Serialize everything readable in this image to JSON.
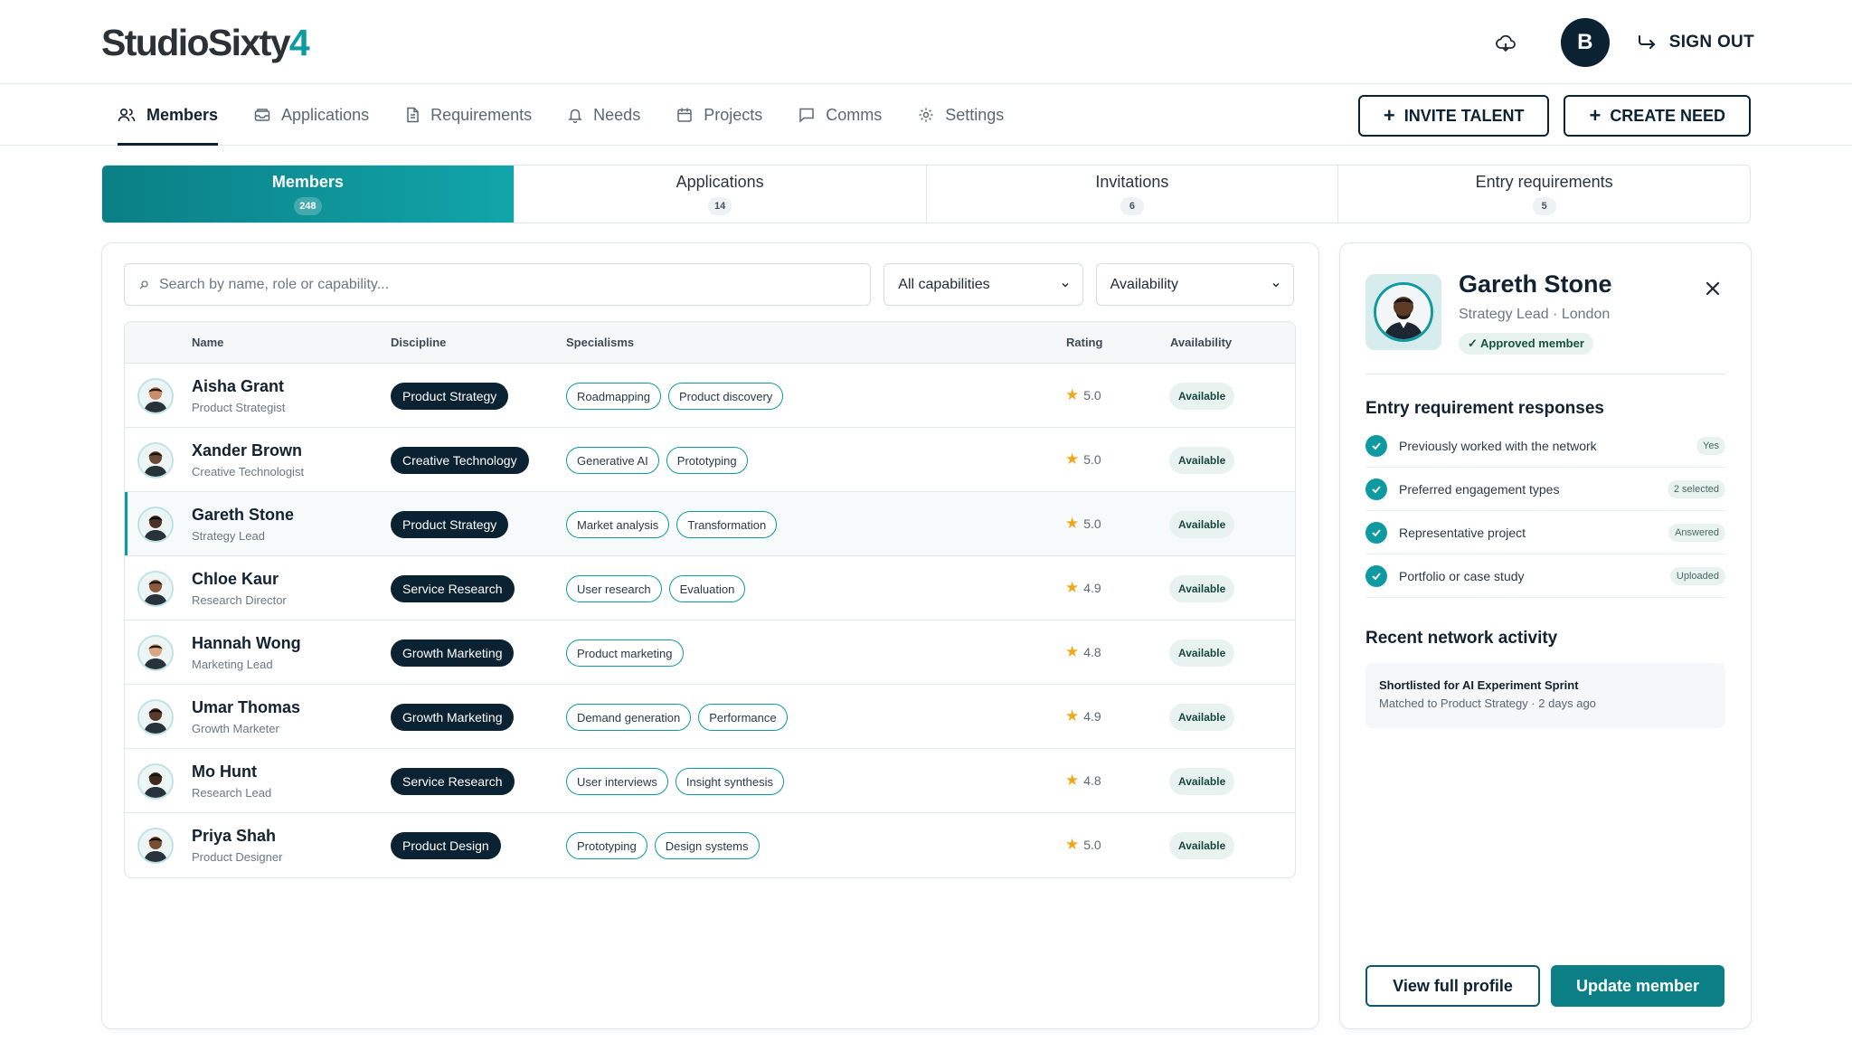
{
  "brand": {
    "logo_main": "StudioSixty",
    "logo_accent": "4",
    "accent_color": "#0e9aa0",
    "dark_color": "#0b2233"
  },
  "header": {
    "avatar_initial": "B",
    "signout_label": "SIGN OUT",
    "cloud_icon": "cloud-icon",
    "signout_icon": "sign-out-arrow-icon"
  },
  "nav": {
    "items": [
      {
        "label": "Members",
        "icon": "users-icon",
        "active": true
      },
      {
        "label": "Applications",
        "icon": "inbox-icon"
      },
      {
        "label": "Requirements",
        "icon": "document-icon"
      },
      {
        "label": "Needs",
        "icon": "bell-icon"
      },
      {
        "label": "Projects",
        "icon": "calendar-icon"
      },
      {
        "label": "Comms",
        "icon": "chat-icon"
      },
      {
        "label": "Settings",
        "icon": "gear-icon"
      }
    ],
    "invite_label": "INVITE TALENT",
    "create_label": "CREATE NEED"
  },
  "subtabs": [
    {
      "label": "Members",
      "count": "248",
      "active": true
    },
    {
      "label": "Applications",
      "count": "14"
    },
    {
      "label": "Invitations",
      "count": "6"
    },
    {
      "label": "Entry requirements",
      "count": "5"
    }
  ],
  "filters": {
    "search_placeholder": "Search by name, role or capability...",
    "capabilities_value": "All capabilities",
    "availability_value": "Availability"
  },
  "table": {
    "columns": [
      "Name",
      "Discipline",
      "Specialisms",
      "Rating",
      "Availability"
    ],
    "rows": [
      {
        "name": "Aisha Grant",
        "role": "Product Strategist",
        "discipline": "Product Strategy",
        "specialisms": [
          "Roadmapping",
          "Product discovery"
        ],
        "rating": "5.0",
        "availability": "Available"
      },
      {
        "name": "Xander Brown",
        "role": "Creative Technologist",
        "discipline": "Creative Technology",
        "specialisms": [
          "Generative AI",
          "Prototyping"
        ],
        "rating": "5.0",
        "availability": "Available"
      },
      {
        "name": "Gareth Stone",
        "role": "Strategy Lead",
        "discipline": "Product Strategy",
        "specialisms": [
          "Market analysis",
          "Transformation"
        ],
        "rating": "5.0",
        "availability": "Available",
        "selected": true
      },
      {
        "name": "Chloe Kaur",
        "role": "Research Director",
        "discipline": "Service Research",
        "specialisms": [
          "User research",
          "Evaluation"
        ],
        "rating": "4.9",
        "availability": "Available"
      },
      {
        "name": "Hannah Wong",
        "role": "Marketing Lead",
        "discipline": "Growth Marketing",
        "specialisms": [
          "Product marketing"
        ],
        "rating": "4.8",
        "availability": "Available"
      },
      {
        "name": "Umar Thomas",
        "role": "Growth Marketer",
        "discipline": "Growth Marketing",
        "specialisms": [
          "Demand generation",
          "Performance"
        ],
        "rating": "4.9",
        "availability": "Available"
      },
      {
        "name": "Mo Hunt",
        "role": "Research Lead",
        "discipline": "Service Research",
        "specialisms": [
          "User interviews",
          "Insight synthesis"
        ],
        "rating": "4.8",
        "availability": "Available"
      },
      {
        "name": "Priya Shah",
        "role": "Product Designer",
        "discipline": "Product Design",
        "specialisms": [
          "Prototyping",
          "Design systems"
        ],
        "rating": "5.0",
        "availability": "Available"
      }
    ]
  },
  "profile": {
    "name": "Gareth Stone",
    "role_location": "Strategy Lead · London",
    "approved": "✓ Approved member",
    "entry_title": "Entry requirement responses",
    "responses": [
      {
        "label": "Previously worked with the network",
        "tag": "Yes"
      },
      {
        "label": "Preferred engagement types",
        "tag": "2 selected"
      },
      {
        "label": "Representative project",
        "tag": "Answered"
      },
      {
        "label": "Portfolio or case study",
        "tag": "Uploaded"
      }
    ],
    "activity_title": "Recent network activity",
    "activity_item_title": "Shortlisted for AI Experiment Sprint",
    "activity_item_sub": "Matched to Product Strategy · 2 days ago",
    "view_label": "View full profile",
    "update_label": "Update member"
  }
}
